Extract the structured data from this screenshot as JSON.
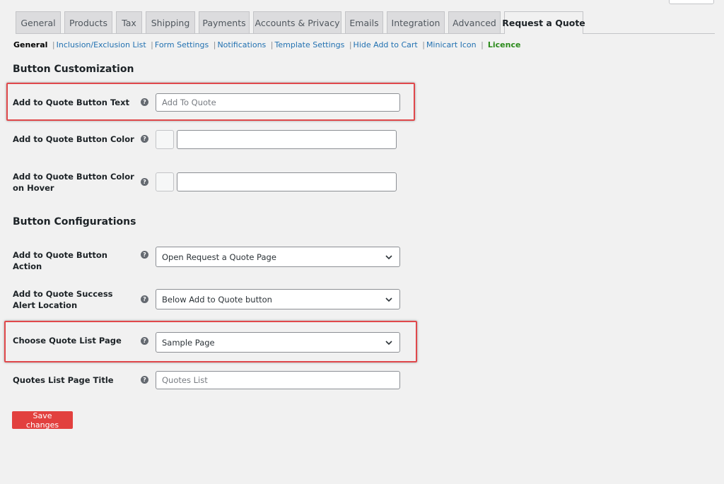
{
  "tabs": [
    "General",
    "Products",
    "Tax",
    "Shipping",
    "Payments",
    "Accounts & Privacy",
    "Emails",
    "Integration",
    "Advanced",
    "Request a Quote"
  ],
  "subnav": {
    "current": "General",
    "links": [
      "Inclusion/Exclusion List",
      "Form Settings",
      "Notifications",
      "Template Settings",
      "Hide Add to Cart",
      "Minicart Icon"
    ],
    "licence": "Licence"
  },
  "sections": {
    "customization": "Button Customization",
    "configurations": "Button Configurations"
  },
  "fields": {
    "button_text": {
      "label": "Add to Quote Button Text",
      "placeholder": "Add To Quote",
      "value": ""
    },
    "button_color": {
      "label": "Add to Quote Button Color",
      "value": ""
    },
    "button_color_hover": {
      "label": "Add to Quote Button Color on Hover",
      "value": ""
    },
    "button_action": {
      "label": "Add to Quote Button Action",
      "selected": "Open Request a Quote Page"
    },
    "success_alert": {
      "label": "Add to Quote Success Alert Location",
      "selected": "Below Add to Quote button"
    },
    "quote_list_page": {
      "label": "Choose Quote List Page",
      "selected": "Sample Page"
    },
    "list_page_title": {
      "label": "Quotes List Page Title",
      "placeholder": "Quotes List",
      "value": ""
    }
  },
  "help_glyph": "?",
  "save_label": "Save changes",
  "colors": {
    "save_button": "#e2403e",
    "highlight": "#e0484b",
    "link": "#2271b1",
    "licence": "#2a8a1a"
  },
  "icons": {
    "help": "question-circle-icon",
    "select": "chevron-down-icon"
  }
}
